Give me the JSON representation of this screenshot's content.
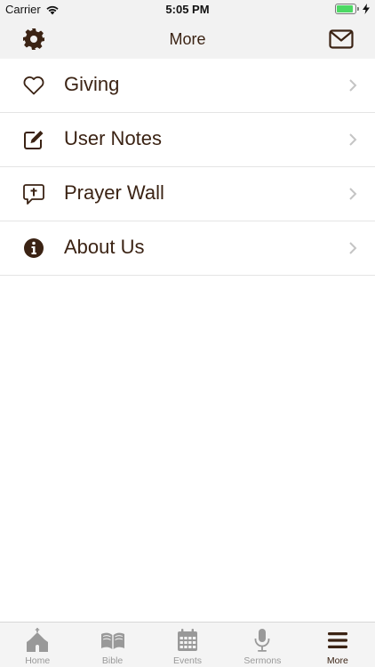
{
  "status_bar": {
    "carrier": "Carrier",
    "time": "5:05 PM",
    "battery_level": 0.9
  },
  "nav_bar": {
    "title": "More"
  },
  "menu": {
    "items": [
      {
        "label": "Giving",
        "icon": "heart-icon"
      },
      {
        "label": "User Notes",
        "icon": "edit-note-icon"
      },
      {
        "label": "Prayer Wall",
        "icon": "prayer-bubble-icon"
      },
      {
        "label": "About Us",
        "icon": "info-icon"
      }
    ]
  },
  "tab_bar": {
    "tabs": [
      {
        "label": "Home",
        "icon": "church-icon",
        "active": false
      },
      {
        "label": "Bible",
        "icon": "book-icon",
        "active": false
      },
      {
        "label": "Events",
        "icon": "calendar-icon",
        "active": false
      },
      {
        "label": "Sermons",
        "icon": "microphone-icon",
        "active": false
      },
      {
        "label": "More",
        "icon": "menu-icon",
        "active": true
      }
    ]
  },
  "colors": {
    "accent": "#3b2314",
    "inactive_tab": "#999999",
    "battery": "#4cd964",
    "bar_background": "#f2f2f2"
  }
}
